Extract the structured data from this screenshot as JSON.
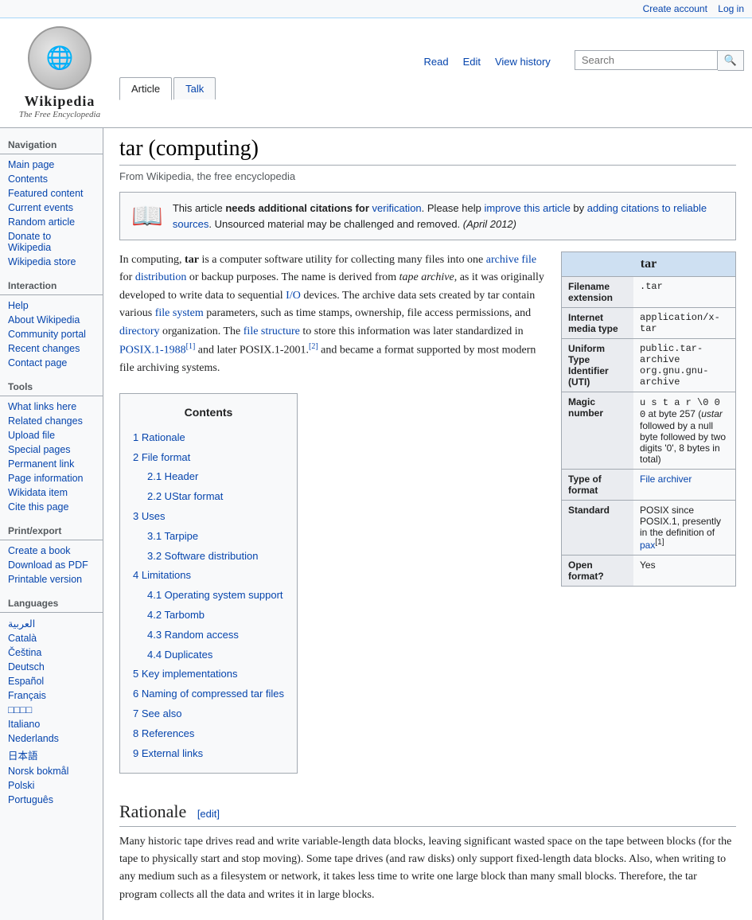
{
  "header": {
    "create_account": "Create account",
    "log_in": "Log in",
    "logo_title": "Wikipedia",
    "logo_subtitle": "The Free Encyclopedia",
    "logo_icon": "🌐",
    "tabs": [
      {
        "label": "Article",
        "active": true
      },
      {
        "label": "Talk",
        "active": false
      }
    ],
    "tabs_right": [
      {
        "label": "Read",
        "active": false
      },
      {
        "label": "Edit",
        "active": false
      },
      {
        "label": "View history",
        "active": false
      }
    ],
    "search_placeholder": "Search"
  },
  "sidebar": {
    "navigation_title": "Navigation",
    "nav_items": [
      "Main page",
      "Contents",
      "Featured content",
      "Current events",
      "Random article",
      "Donate to Wikipedia",
      "Wikipedia store"
    ],
    "interaction_title": "Interaction",
    "interaction_items": [
      "Help",
      "About Wikipedia",
      "Community portal",
      "Recent changes",
      "Contact page"
    ],
    "tools_title": "Tools",
    "tools_items": [
      "What links here",
      "Related changes",
      "Upload file",
      "Special pages",
      "Permanent link",
      "Page information",
      "Wikidata item",
      "Cite this page"
    ],
    "print_title": "Print/export",
    "print_items": [
      "Create a book",
      "Download as PDF",
      "Printable version"
    ],
    "languages_title": "Languages",
    "language_items": [
      "العربية",
      "Català",
      "Čeština",
      "Deutsch",
      "Español",
      "Français",
      "□□□□",
      "Italiano",
      "Nederlands",
      "日本語",
      "Norsk bokmål",
      "Polski",
      "Português"
    ]
  },
  "page": {
    "title": "tar (computing)",
    "subtitle": "From Wikipedia, the free encyclopedia",
    "notice": {
      "icon": "📖",
      "text1": "This article ",
      "bold1": "needs additional citations for",
      "link1": "verification",
      "text2": ". Please help ",
      "link2": "improve this article",
      "text3": " by ",
      "link3": "adding citations to reliable sources",
      "text4": ". Unsourced material may be challenged and removed. ",
      "italic1": "(April 2012)"
    },
    "intro": "In computing, tar is a computer software utility for collecting many files into one archive file for distribution or backup purposes. The name is derived from tape archive, as it was originally developed to write data to sequential I/O devices. The archive data sets created by tar contain various file system parameters, such as time stamps, ownership, file access permissions, and directory organization. The file structure to store this information was later standardized in POSIX.1-1988[1] and later POSIX.1-2001.[2] and became a format supported by most modern file archiving systems.",
    "infobox": {
      "title": "tar",
      "rows": [
        {
          "label": "Filename extension",
          "value": ".tar",
          "type": "mono"
        },
        {
          "label": "Internet media type",
          "value": "application/x-tar",
          "type": "mono"
        },
        {
          "label": "Uniform Type Identifier (UTI)",
          "value": "public.tar-archive\norg.gnu.gnu-archive",
          "type": "mono"
        },
        {
          "label": "Magic number",
          "value": "u s t a r \\0 0 0  at byte 257 (ustar followed by a null byte followed by two digits '0', 8 bytes in total)",
          "type": "normal"
        },
        {
          "label": "Type of format",
          "value": "File archiver",
          "type": "link"
        },
        {
          "label": "Standard",
          "value": "POSIX since POSIX.1, presently in the definition of pax[1]",
          "type": "normal"
        },
        {
          "label": "Open format?",
          "value": "Yes",
          "type": "normal"
        }
      ]
    },
    "contents": {
      "title": "Contents",
      "items": [
        {
          "num": "1",
          "label": "Rationale",
          "sub": []
        },
        {
          "num": "2",
          "label": "File format",
          "sub": [
            {
              "num": "2.1",
              "label": "Header"
            },
            {
              "num": "2.2",
              "label": "UStar format"
            }
          ]
        },
        {
          "num": "3",
          "label": "Uses",
          "sub": [
            {
              "num": "3.1",
              "label": "Tarpipe"
            },
            {
              "num": "3.2",
              "label": "Software distribution"
            }
          ]
        },
        {
          "num": "4",
          "label": "Limitations",
          "sub": [
            {
              "num": "4.1",
              "label": "Operating system support"
            },
            {
              "num": "4.2",
              "label": "Tarbomb"
            },
            {
              "num": "4.3",
              "label": "Random access"
            },
            {
              "num": "4.4",
              "label": "Duplicates"
            }
          ]
        },
        {
          "num": "5",
          "label": "Key implementations",
          "sub": []
        },
        {
          "num": "6",
          "label": "Naming of compressed tar files",
          "sub": []
        },
        {
          "num": "7",
          "label": "See also",
          "sub": []
        },
        {
          "num": "8",
          "label": "References",
          "sub": []
        },
        {
          "num": "9",
          "label": "External links",
          "sub": []
        }
      ]
    },
    "rationale_title": "Rationale",
    "rationale_edit": "[edit]",
    "rationale_text": "Many historic tape drives read and write variable-length data blocks, leaving significant wasted space on the tape between blocks (for the tape to physically start and stop moving). Some tape drives (and raw disks) only support fixed-length data blocks. Also, when writing to any medium such as a filesystem or network, it takes less time to write one large block than many small blocks. Therefore, the tar program collects all the data and writes it in large blocks."
  }
}
